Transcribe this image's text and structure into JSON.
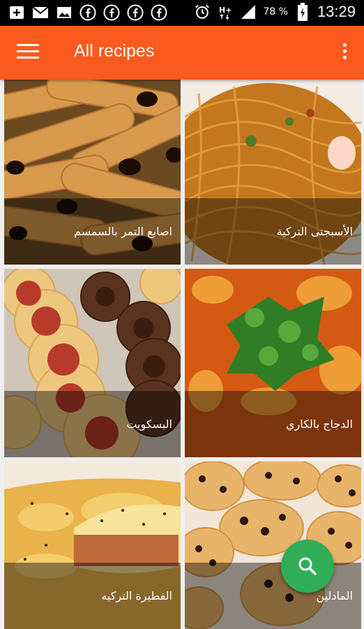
{
  "status_bar": {
    "left_icons": [
      "add-box-icon",
      "mail-icon",
      "image-icon",
      "facebook-icon",
      "facebook-icon",
      "facebook-icon",
      "facebook-icon"
    ],
    "right_icons": [
      "alarm-icon",
      "data-hplus-icon",
      "signal-icon",
      "battery-icon"
    ],
    "battery": "78 %",
    "time": "13:29"
  },
  "app_bar": {
    "title": "All recipes",
    "color": "#fb5a1e"
  },
  "recipes": [
    {
      "name": "اصابع التمر بالسمسم",
      "image": "sesame-date-fingers-photo"
    },
    {
      "name": "الأسبجتى التركية",
      "image": "turkish-spaghetti-photo"
    },
    {
      "name": "البسكويت",
      "image": "biscuits-photo"
    },
    {
      "name": "الدجاج بالكاري",
      "image": "curry-chicken-photo"
    },
    {
      "name": "الفطيرة التركيه",
      "image": "turkish-pie-photo"
    },
    {
      "name": "المادلين",
      "image": "madeleine-muffins-photo"
    }
  ],
  "fab": {
    "icon": "search-icon",
    "color": "#2fae57"
  }
}
